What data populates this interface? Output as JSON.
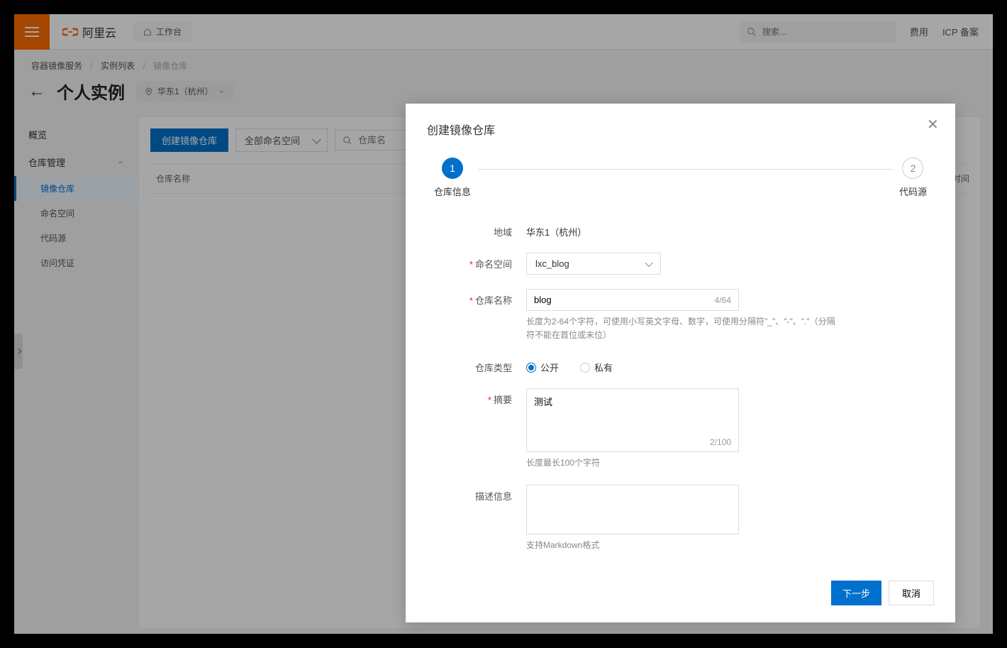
{
  "brand": {
    "name": "阿里云"
  },
  "topbar": {
    "workspace_label": "工作台",
    "search_placeholder": "搜索...",
    "fee_label": "费用",
    "icp_label": "ICP 备案"
  },
  "breadcrumb": {
    "item1": "容器镜像服务",
    "item2": "实例列表",
    "item3": "镜像仓库"
  },
  "page": {
    "title": "个人实例",
    "region": "华东1（杭州）"
  },
  "sidebar": {
    "overview": "概览",
    "repo_mgmt": "仓库管理",
    "items": {
      "image_repo": "镜像仓库",
      "namespace": "命名空间",
      "code_source": "代码源",
      "access_cred": "访问凭证"
    }
  },
  "content": {
    "create_btn": "创建镜像仓库",
    "namespace_filter": "全部命名空间",
    "search_placeholder": "仓库名",
    "th_name": "仓库名称",
    "th_time": "时间"
  },
  "modal": {
    "title": "创建镜像仓库",
    "step1_label": "仓库信息",
    "step2_label": "代码源",
    "step1_num": "1",
    "step2_num": "2",
    "labels": {
      "region": "地域",
      "namespace": "命名空间",
      "repo_name": "仓库名称",
      "repo_type": "仓库类型",
      "summary": "摘要",
      "description": "描述信息"
    },
    "values": {
      "region": "华东1（杭州）",
      "namespace": "lxc_blog",
      "repo_name": "blog",
      "repo_name_count": "4/64",
      "repo_name_help": "长度为2-64个字符，可使用小写英文字母、数字，可使用分隔符\"_\"、\"-\"、\".\"（分隔符不能在首位或末位）",
      "type_public": "公开",
      "type_private": "私有",
      "summary": "测试",
      "summary_count": "2/100",
      "summary_help": "长度最长100个字符",
      "description": "",
      "description_help": "支持Markdown格式"
    },
    "footer": {
      "next": "下一步",
      "cancel": "取消"
    }
  }
}
